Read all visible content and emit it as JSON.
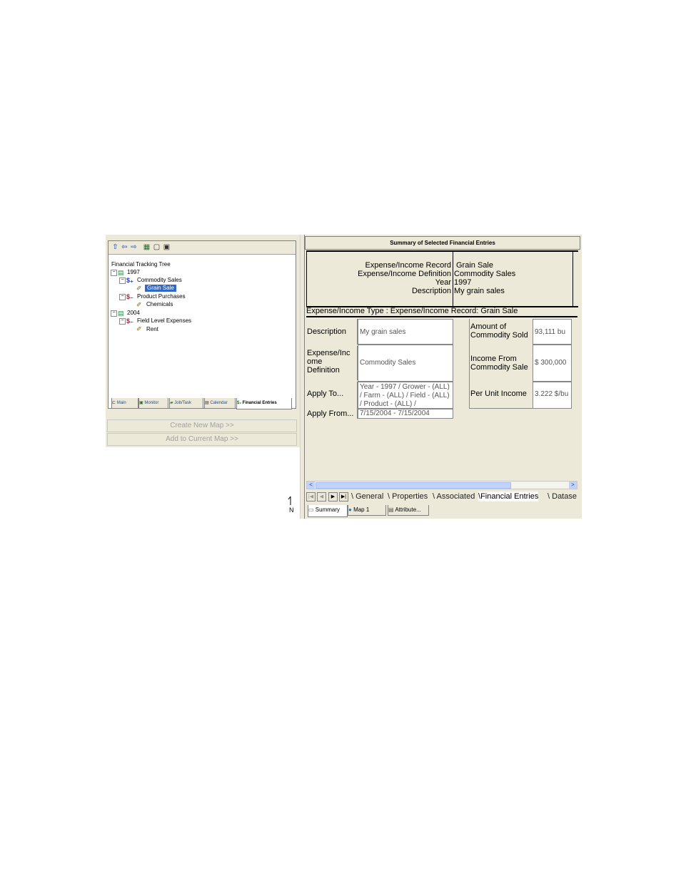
{
  "tree": {
    "title": "Financial Tracking Tree",
    "nodes": {
      "y1997": "1997",
      "commodity_sales": "Commodity Sales",
      "grain_sale": "Grain Sale",
      "product_purchases": "Product Purchases",
      "chemicals": "Chemicals",
      "y2004": "2004",
      "field_level_expenses": "Field Level Expenses",
      "rent": "Rent"
    }
  },
  "left_tabs": [
    "Main",
    "Monitor",
    "Job/Task",
    "Calendar",
    "Financial Entries"
  ],
  "buttons": {
    "create_new_map": "Create New Map  >>",
    "add_to_current_map": "Add to Current Map  >>"
  },
  "north_arrow": {
    "label": "N"
  },
  "summary": {
    "title": "Summary of Selected Financial Entries",
    "header": {
      "labels": [
        "Expense/Income Record",
        "Expense/Income Definition",
        "Year",
        "Description"
      ],
      "values": [
        "Grain Sale",
        "Commodity Sales",
        "1997",
        "My grain sales"
      ]
    },
    "type_line": "Expense/Income Type : Expense/Income Record:  Grain Sale",
    "fields": {
      "description_label": "Description",
      "description_value": "My grain sales",
      "definition_label": "Expense/Inc ome Definition",
      "definition_value": "Commodity Sales",
      "apply_to_label": "Apply To...",
      "apply_to_value": "Year - 1997 / Grower - (ALL) / Farm - (ALL) / Field - (ALL) / Product - (ALL) /",
      "apply_from_label": "Apply From...",
      "apply_from_value": "7/15/2004 - 7/15/2004",
      "amount_label": "Amount of Commodity Sold",
      "amount_value": "93,111 bu",
      "income_label": "Income From Commodity Sale",
      "income_value": "$ 300,000",
      "per_unit_label": "Per Unit Income",
      "per_unit_value": "3.222 $/bu"
    }
  },
  "sheet_tabs": [
    "General",
    "Properties",
    "Associated",
    "Financial Entries",
    "Datase"
  ],
  "bottom_tabs": [
    "Summary",
    "Map 1",
    "Attribute..."
  ]
}
